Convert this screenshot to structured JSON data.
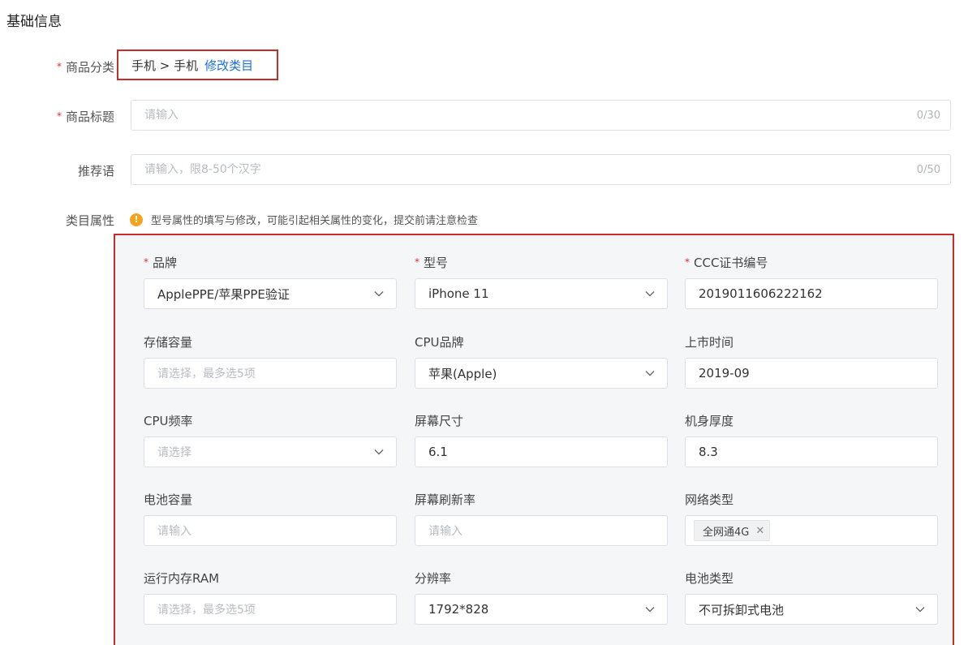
{
  "section_title": "基础信息",
  "category": {
    "label": "商品分类",
    "path": "手机 > 手机",
    "link": "修改类目"
  },
  "title_field": {
    "label": "商品标题",
    "placeholder": "请输入",
    "counter": "0/30"
  },
  "slogan_field": {
    "label": "推荐语",
    "placeholder": "请输入，限8-50个汉字",
    "counter": "0/50"
  },
  "attributes": {
    "label": "类目属性",
    "notice_icon": "!",
    "notice": "型号属性的填写与修改，可能引起相关属性的变化，提交前请注意检查",
    "fields": [
      {
        "label": "品牌",
        "required": true,
        "value": "ApplePPE/苹果PPE验证",
        "placeholder": "",
        "type": "select"
      },
      {
        "label": "型号",
        "required": true,
        "value": "iPhone 11",
        "placeholder": "",
        "type": "select"
      },
      {
        "label": "CCC证书编号",
        "required": true,
        "value": "2019011606222162",
        "placeholder": "",
        "type": "input"
      },
      {
        "label": "存储容量",
        "required": false,
        "value": "",
        "placeholder": "请选择，最多选5项",
        "type": "multiselect"
      },
      {
        "label": "CPU品牌",
        "required": false,
        "value": "苹果(Apple)",
        "placeholder": "",
        "type": "select"
      },
      {
        "label": "上市时间",
        "required": false,
        "value": "2019-09",
        "placeholder": "",
        "type": "input"
      },
      {
        "label": "CPU频率",
        "required": false,
        "value": "",
        "placeholder": "请选择",
        "type": "select"
      },
      {
        "label": "屏幕尺寸",
        "required": false,
        "value": "6.1",
        "placeholder": "",
        "type": "input"
      },
      {
        "label": "机身厚度",
        "required": false,
        "value": "8.3",
        "placeholder": "",
        "type": "input"
      },
      {
        "label": "电池容量",
        "required": false,
        "value": "",
        "placeholder": "请输入",
        "type": "input"
      },
      {
        "label": "屏幕刷新率",
        "required": false,
        "value": "",
        "placeholder": "请输入",
        "type": "input"
      },
      {
        "label": "网络类型",
        "required": false,
        "value": "",
        "placeholder": "",
        "type": "tags",
        "tags": [
          "全网通4G"
        ]
      },
      {
        "label": "运行内存RAM",
        "required": false,
        "value": "",
        "placeholder": "请选择，最多选5项",
        "type": "multiselect"
      },
      {
        "label": "分辨率",
        "required": false,
        "value": "1792*828",
        "placeholder": "",
        "type": "select"
      },
      {
        "label": "电池类型",
        "required": false,
        "value": "不可拆卸式电池",
        "placeholder": "",
        "type": "select"
      }
    ]
  },
  "colors": {
    "required_star": "#e02d2d",
    "highlight_border": "#c62c2c",
    "link": "#1f6fd6",
    "notice_icon": "#f4a31c"
  }
}
